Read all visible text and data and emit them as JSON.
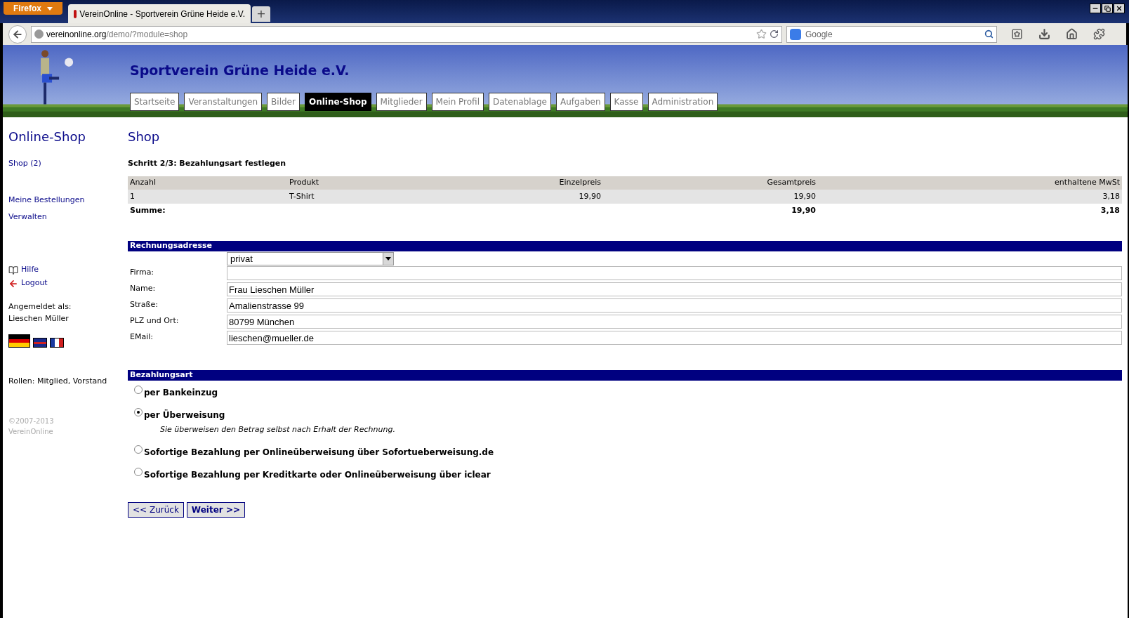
{
  "browser": {
    "menu_button": "Firefox",
    "tabs": [
      {
        "title": "VereinOnline - Sportverein Grüne Heide e.V.",
        "selected": true
      }
    ],
    "new_tab": "+",
    "url_host": "vereinonline.org",
    "url_path": "/demo/?module=shop",
    "search_placeholder": "Google"
  },
  "site": {
    "title": "Sportverein Grüne Heide e.V.",
    "nav": [
      {
        "label": "Startseite",
        "selected": false
      },
      {
        "label": "Veranstaltungen",
        "selected": false
      },
      {
        "label": "Bilder",
        "selected": false
      },
      {
        "label": "Online-Shop",
        "selected": true
      },
      {
        "label": "Mitglieder",
        "selected": false
      },
      {
        "label": "Mein Profil",
        "selected": false
      },
      {
        "label": "Datenablage",
        "selected": false
      },
      {
        "label": "Aufgaben",
        "selected": false
      },
      {
        "label": "Kasse",
        "selected": false
      },
      {
        "label": "Administration",
        "selected": false
      }
    ]
  },
  "sidebar": {
    "heading": "Online-Shop",
    "links": [
      "Shop (2)"
    ],
    "links2": [
      "Meine Bestellungen",
      "Verwalten"
    ],
    "help": "Hilfe",
    "logout": "Logout",
    "logged_in_label": "Angemeldet als:",
    "user": "Lieschen Müller",
    "roles": "Rollen: Mitglied, Vorstand",
    "copyright": "©2007-2013",
    "copyright_owner": "VereinOnline"
  },
  "main": {
    "heading": "Shop",
    "step": "Schritt 2/3: Bezahlungsart festlegen",
    "table": {
      "columns": [
        "Anzahl",
        "Produkt",
        "Einzelpreis",
        "Gesamtpreis",
        "enthaltene MwSt"
      ],
      "rows": [
        [
          "1",
          "T-Shirt",
          "19,90",
          "19,90",
          "3,18"
        ]
      ],
      "total": {
        "label": "Summe:",
        "gesamtpreis": "19,90",
        "mwst": "3,18"
      }
    },
    "address": {
      "title": "Rechnungsadresse",
      "type_select": "privat",
      "fields": [
        {
          "label": "Firma:"
        },
        {
          "label": "Name:",
          "value": "Frau Lieschen Müller"
        },
        {
          "label": "Straße:",
          "value": "Amalienstrasse 99"
        },
        {
          "label": "PLZ und Ort:",
          "value": "80799 München"
        },
        {
          "label": "EMail:",
          "value": "lieschen@mueller.de"
        }
      ]
    },
    "payment": {
      "title": "Bezahlungsart",
      "options": [
        {
          "label": "per Bankeinzug",
          "selected": false
        },
        {
          "label": "per Überweisung",
          "selected": true,
          "note": "Sie überweisen den Betrag selbst nach Erhalt der Rechnung."
        },
        {
          "label": "Sofortige Bezahlung per Onlineüberweisung über Sofortueberweisung.de",
          "selected": false
        },
        {
          "label": "Sofortige Bezahlung per Kreditkarte oder Onlineüberweisung über iclear",
          "selected": false
        }
      ]
    },
    "buttons": [
      {
        "label": "<< Zurück",
        "kind": "back"
      },
      {
        "label": "Weiter >>",
        "kind": "next"
      }
    ]
  }
}
